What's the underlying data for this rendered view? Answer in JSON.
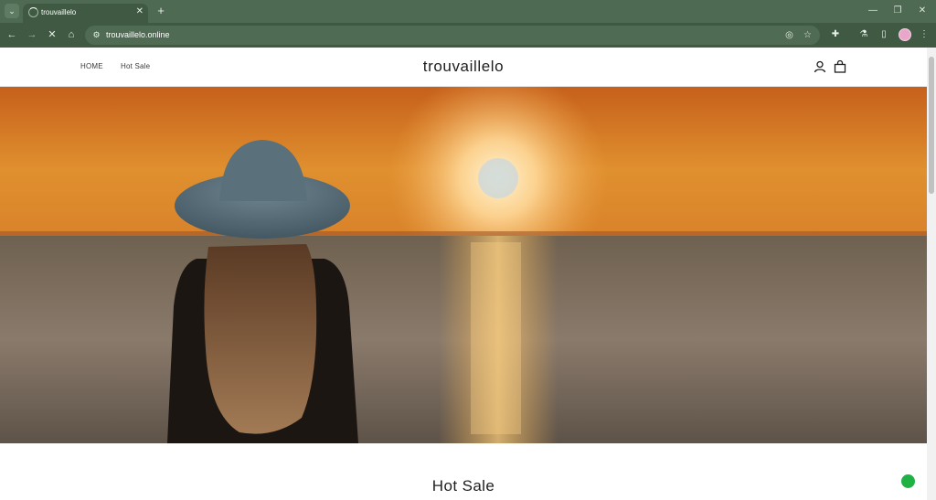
{
  "browser": {
    "tab": {
      "title": "trouvaillelo"
    },
    "url": "trouvaillelo.online"
  },
  "site": {
    "brand": "trouvaillelo",
    "nav": [
      "HOME",
      "Hot Sale"
    ],
    "section_title": "Hot Sale"
  },
  "colors": {
    "chrome_dark": "#3f5943",
    "chrome_light": "#4e6a52",
    "sky_top": "#c4621a",
    "sun": "#ffe7b5",
    "sea": "#7a6a5a",
    "chat": "#1fb144"
  }
}
